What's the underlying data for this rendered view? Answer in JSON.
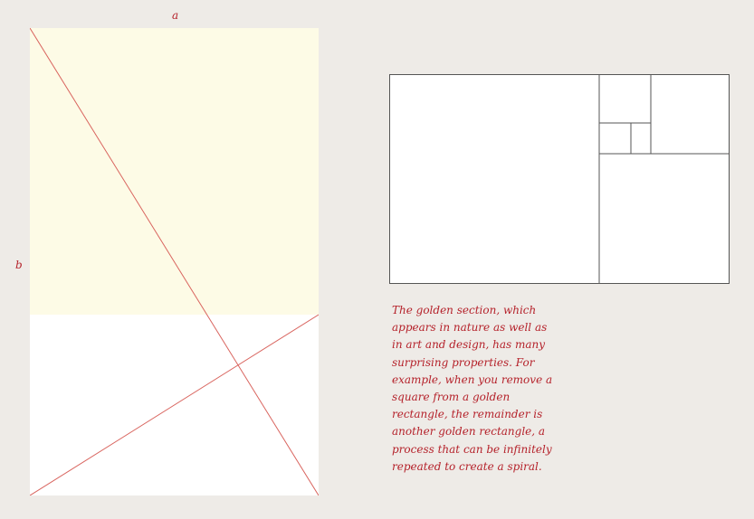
{
  "labels": {
    "a": "a",
    "b": "b"
  },
  "caption": "The golden section, which appears in nature as well as in art and design, has many surprising properties. For example, when you remove a square from a golden rectangle, the remainder is another golden rectangle, a process that can be infinitely repeated to create a spiral.",
  "colors": {
    "background": "#eeebe7",
    "upper_fill": "#fdfbe6",
    "lower_fill": "#ffffff",
    "accent_red": "#b5222b",
    "diagonal_line": "#d9655f",
    "outline": "#555555"
  }
}
